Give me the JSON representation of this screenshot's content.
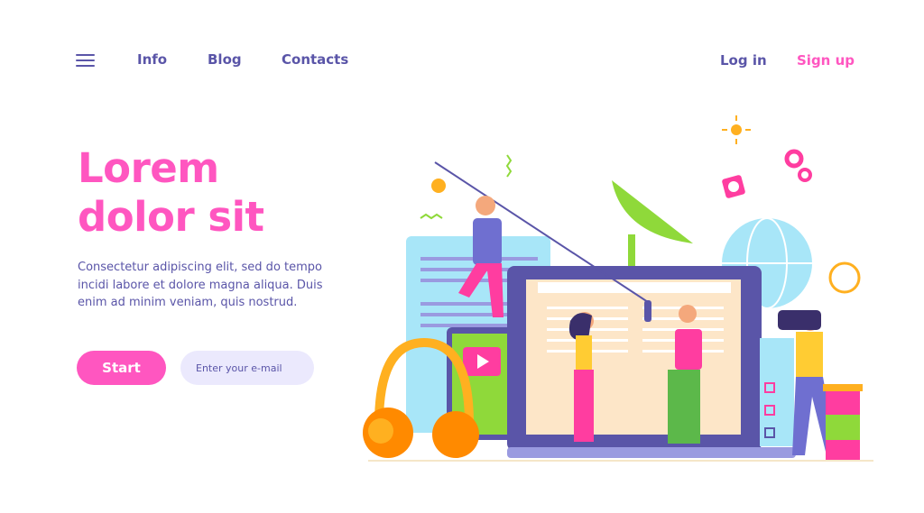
{
  "header": {
    "menu_icon": "hamburger-menu-icon",
    "nav": [
      {
        "label": "Info"
      },
      {
        "label": "Blog"
      },
      {
        "label": "Contacts"
      }
    ],
    "login_label": "Log in",
    "signup_label": "Sign up"
  },
  "hero": {
    "title_line1": "Lorem",
    "title_line2": "dolor sit",
    "description": "Consectetur adipiscing elit, sed do tempo incidi labore et dolore magna aliqua. Duis enim ad minim veniam, quis nostrud.",
    "start_label": "Start",
    "email_placeholder": "Enter your e-mail"
  },
  "colors": {
    "primary": "#5a55a8",
    "accent": "#ff56c0",
    "input_bg": "#ebe9fd"
  }
}
